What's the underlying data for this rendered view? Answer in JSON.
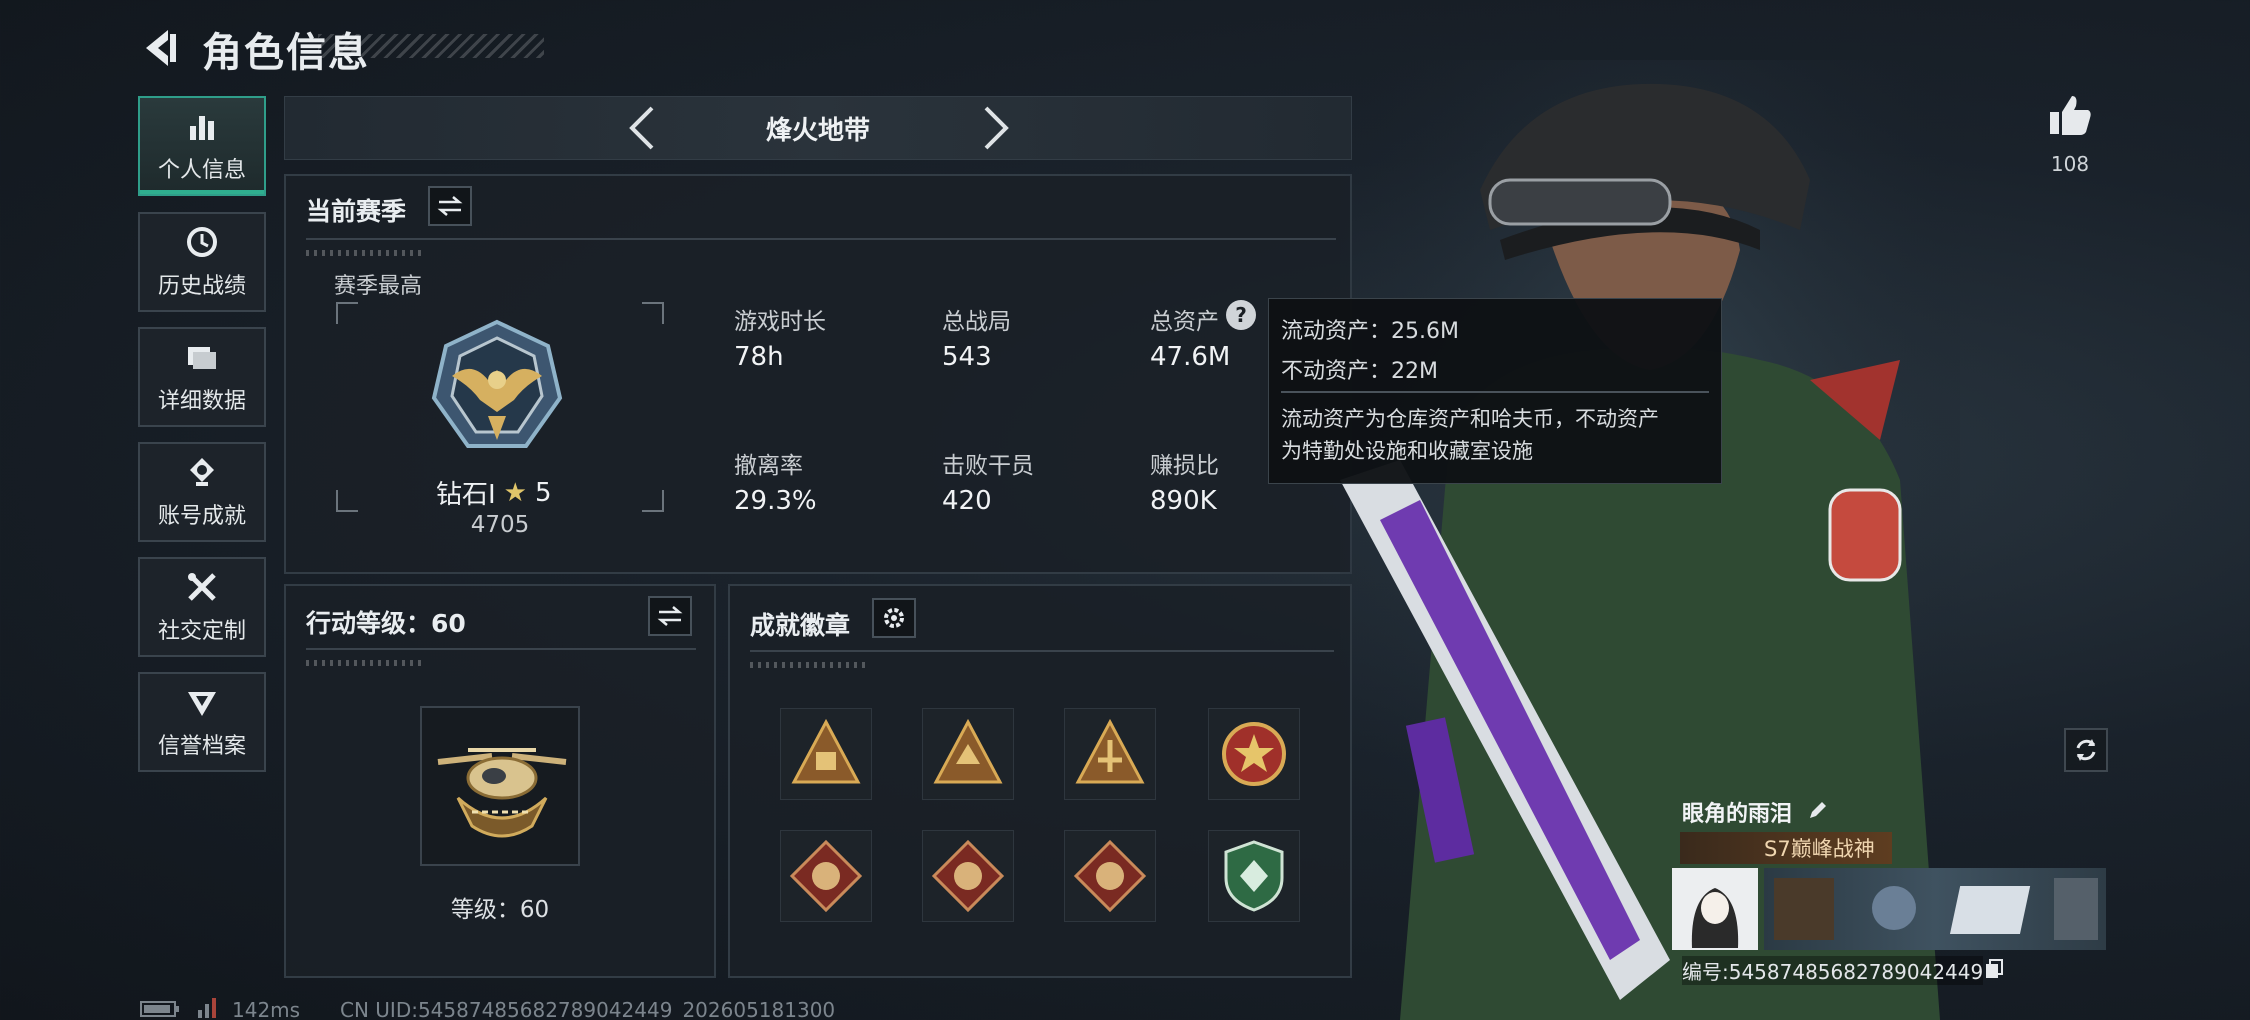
{
  "header": {
    "title": "角色信息",
    "back_icon": "back-arrow-icon"
  },
  "nav": {
    "items": [
      {
        "label": "个人信息",
        "icon": "bar-chart-icon",
        "active": true
      },
      {
        "label": "历史战绩",
        "icon": "history-clock-icon",
        "active": false
      },
      {
        "label": "详细数据",
        "icon": "folder-icon",
        "active": false
      },
      {
        "label": "账号成就",
        "icon": "achievement-icon",
        "active": false
      },
      {
        "label": "社交定制",
        "icon": "tools-icon",
        "active": false
      },
      {
        "label": "信誉档案",
        "icon": "reputation-icon",
        "active": false
      }
    ]
  },
  "mode": {
    "label": "烽火地带"
  },
  "season": {
    "title": "当前赛季",
    "best_label": "赛季最高",
    "rank_name": "钻石Ⅰ",
    "rank_stars": "5",
    "rank_points": "4705",
    "stats": [
      {
        "label": "游戏时长",
        "value": "78h"
      },
      {
        "label": "总战局",
        "value": "543"
      },
      {
        "label": "总资产",
        "value": "47.6M"
      },
      {
        "label": "撤离率",
        "value": "29.3%"
      },
      {
        "label": "击败干员",
        "value": "420"
      },
      {
        "label": "赚损比",
        "value": "890K"
      }
    ],
    "help_glyph": "?"
  },
  "tooltip": {
    "line1": "流动资产：25.6M",
    "line2": "不动资产：22M",
    "desc1": "流动资产为仓库资产和哈夫币，不动资产",
    "desc2": "为特勤处设施和收藏室设施"
  },
  "level": {
    "title": "行动等级：60",
    "caption": "等级：60"
  },
  "badges": {
    "title": "成就徽章",
    "settings_icon": "gear-icon"
  },
  "profile": {
    "likes": "108",
    "name": "眼角的雨泪",
    "title_tag": "S7巅峰战神",
    "id_line": "编号:54587485682789042449"
  },
  "footer": {
    "ping": "142ms",
    "uid": "CN UID:54587485682789042449_202605181300"
  },
  "colors": {
    "accent": "#2fae8f",
    "gold": "#c9a24a",
    "panel": "#1a2027"
  }
}
